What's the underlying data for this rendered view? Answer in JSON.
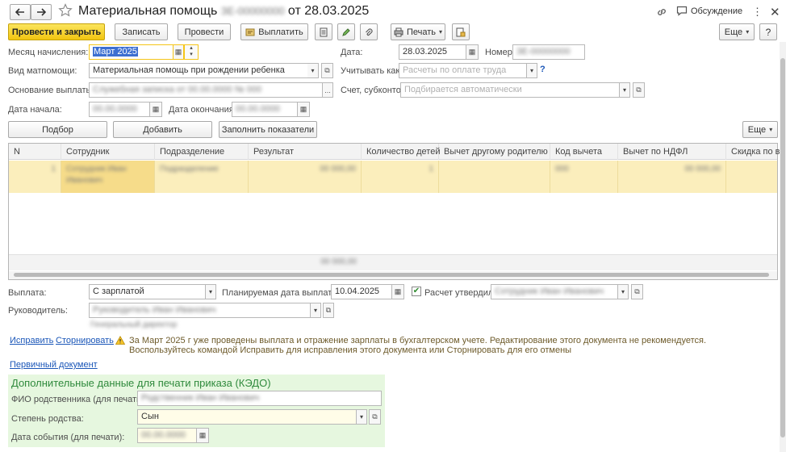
{
  "header": {
    "title_prefix": "Материальная помощь",
    "title_number": "ЗЕ-00000000",
    "title_suffix": "от 28.03.2025",
    "discussion": "Обсуждение"
  },
  "toolbar": {
    "post_close": "Провести и закрыть",
    "save": "Записать",
    "post": "Провести",
    "pay": "Выплатить",
    "print": "Печать",
    "more": "Еще"
  },
  "form": {
    "month_label": "Месяц начисления:",
    "month_value": "Март 2025",
    "date_label": "Дата:",
    "date_value": "28.03.2025",
    "number_label": "Номер:",
    "number_value": "ЗЕ-00000000",
    "kind_label": "Вид матпомощи:",
    "kind_value": "Материальная помощь при рождении ребенка",
    "consider_label": "Учитывать как:",
    "consider_placeholder": "Расчеты по оплате труда",
    "help": "?",
    "basis_label": "Основание выплаты:",
    "basis_value": "Служебная записка от 00.00.0000 № 000",
    "ellipsis": "...",
    "account_label": "Счет, субконто:",
    "account_placeholder": "Подбирается автоматически",
    "start_label": "Дата начала:",
    "start_value": "00.00.0000",
    "end_label": "Дата окончания:",
    "end_value": "00.00.0000"
  },
  "table_bar": {
    "pick": "Подбор",
    "add": "Добавить",
    "fill": "Заполнить показатели",
    "more": "Еще"
  },
  "table": {
    "columns": [
      "N",
      "Сотрудник",
      "Подразделение",
      "Результат",
      "Количество детей",
      "Вычет другому родителю",
      "Код вычета",
      "Вычет по НДФЛ",
      "Скидка по в"
    ],
    "row": {
      "n": "1",
      "employee": "Сотрудник Иван Иванович",
      "department": "Подразделение",
      "result": "00 000,00",
      "children": "1",
      "deduction_other": "",
      "code": "000",
      "ndfl": "00 000,00"
    },
    "total": "00 000,00"
  },
  "payment": {
    "label": "Выплата:",
    "value": "С зарплатой",
    "plan_label": "Планируемая дата выплаты:",
    "plan_value": "10.04.2025",
    "approved_label": "Расчет утвердил",
    "approved_value": "Сотрудник Иван Иванович"
  },
  "manager": {
    "label": "Руководитель:",
    "value": "Руководитель Иван Иванович",
    "position": "Генеральный директор"
  },
  "warning": {
    "fix": "Исправить",
    "reverse": "Сторнировать",
    "line1": "За Март 2025 г уже проведены выплата и отражение зарплаты в бухгалтерском учете. Редактирование этого документа не рекомендуется.",
    "line2": "Воспользуйтесь командой Исправить для исправления этого документа или Сторнировать для его отмены"
  },
  "primary_doc": "Первичный документ",
  "extra": {
    "title": "Дополнительные данные для печати приказа (КЭДО)",
    "fio_label": "ФИО родственника (для печати):",
    "fio_value": "Родственник Иван Иванович",
    "degree_label": "Степень родства:",
    "degree_value": "Сын",
    "event_label": "Дата события (для печати):",
    "event_value": "00.00.0000"
  },
  "colors": {
    "accent_yellow": "#f5cf2a",
    "selected_row": "#fbeebc",
    "panel_green": "#e6f7df",
    "link": "#1a56b8",
    "focus": "#f5c518"
  }
}
